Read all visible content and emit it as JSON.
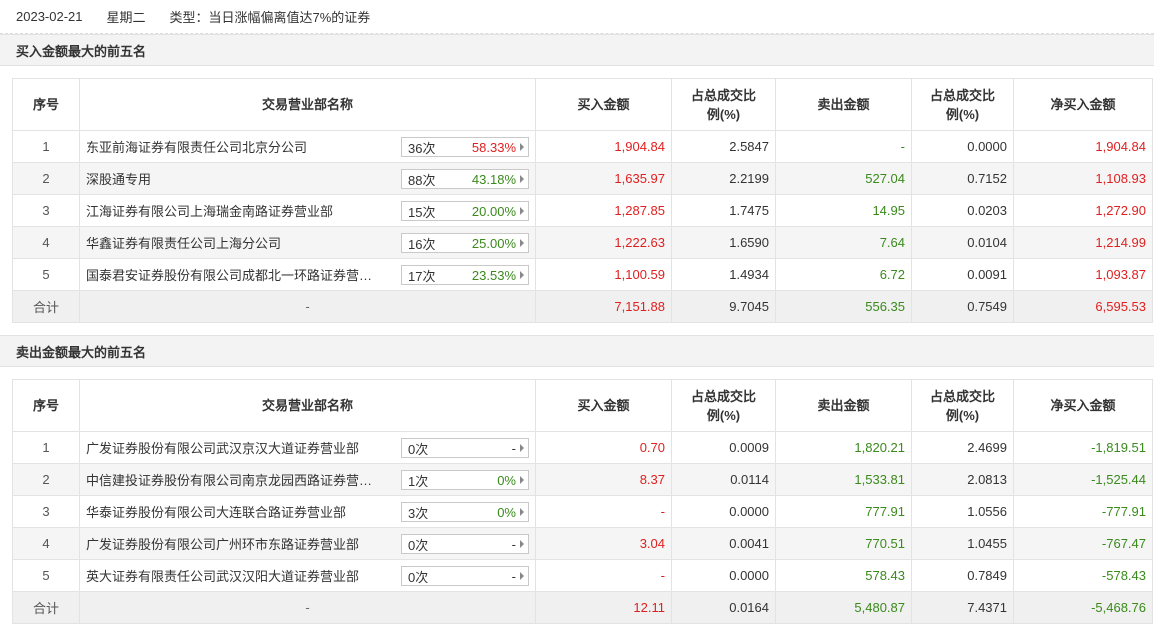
{
  "header": {
    "date": "2023-02-21",
    "weekday": "星期二",
    "type": "类型：当日涨幅偏离值达7%的证券"
  },
  "columns": [
    "序号",
    "交易营业部名称",
    "买入金额",
    "占总成交比例(%)",
    "卖出金额",
    "占总成交比例(%)",
    "净买入金额"
  ],
  "buy_section": {
    "title": "买入金额最大的前五名",
    "rows": [
      {
        "idx": "1",
        "name": "东亚前海证券有限责任公司北京分公司",
        "times": "36次",
        "pct": "58.33%",
        "pct_color": "red",
        "buy": "1,904.84",
        "buy_ratio": "2.5847",
        "sell": "-",
        "sell_ratio": "0.0000",
        "net": "1,904.84",
        "net_color": "red"
      },
      {
        "idx": "2",
        "name": "深股通专用",
        "times": "88次",
        "pct": "43.18%",
        "pct_color": "green",
        "buy": "1,635.97",
        "buy_ratio": "2.2199",
        "sell": "527.04",
        "sell_ratio": "0.7152",
        "net": "1,108.93",
        "net_color": "red"
      },
      {
        "idx": "3",
        "name": "江海证券有限公司上海瑞金南路证券营业部",
        "times": "15次",
        "pct": "20.00%",
        "pct_color": "green",
        "buy": "1,287.85",
        "buy_ratio": "1.7475",
        "sell": "14.95",
        "sell_ratio": "0.0203",
        "net": "1,272.90",
        "net_color": "red"
      },
      {
        "idx": "4",
        "name": "华鑫证券有限责任公司上海分公司",
        "times": "16次",
        "pct": "25.00%",
        "pct_color": "green",
        "buy": "1,222.63",
        "buy_ratio": "1.6590",
        "sell": "7.64",
        "sell_ratio": "0.0104",
        "net": "1,214.99",
        "net_color": "red"
      },
      {
        "idx": "5",
        "name": "国泰君安证券股份有限公司成都北一环路证券营…",
        "times": "17次",
        "pct": "23.53%",
        "pct_color": "green",
        "buy": "1,100.59",
        "buy_ratio": "1.4934",
        "sell": "6.72",
        "sell_ratio": "0.0091",
        "net": "1,093.87",
        "net_color": "red"
      }
    ],
    "total": {
      "label": "合计",
      "name": "-",
      "buy": "7,151.88",
      "buy_ratio": "9.7045",
      "sell": "556.35",
      "sell_ratio": "0.7549",
      "net": "6,595.53",
      "net_color": "red"
    }
  },
  "sell_section": {
    "title": "卖出金额最大的前五名",
    "rows": [
      {
        "idx": "1",
        "name": "广发证券股份有限公司武汉京汉大道证券营业部",
        "times": "0次",
        "pct": "-",
        "pct_color": "dark",
        "buy": "0.70",
        "buy_ratio": "0.0009",
        "sell": "1,820.21",
        "sell_ratio": "2.4699",
        "net": "-1,819.51",
        "net_color": "green"
      },
      {
        "idx": "2",
        "name": "中信建投证券股份有限公司南京龙园西路证券营…",
        "times": "1次",
        "pct": "0%",
        "pct_color": "green",
        "buy": "8.37",
        "buy_ratio": "0.0114",
        "sell": "1,533.81",
        "sell_ratio": "2.0813",
        "net": "-1,525.44",
        "net_color": "green"
      },
      {
        "idx": "3",
        "name": "华泰证券股份有限公司大连联合路证券营业部",
        "times": "3次",
        "pct": "0%",
        "pct_color": "green",
        "buy": "-",
        "buy_ratio": "0.0000",
        "sell": "777.91",
        "sell_ratio": "1.0556",
        "net": "-777.91",
        "net_color": "green"
      },
      {
        "idx": "4",
        "name": "广发证券股份有限公司广州环市东路证券营业部",
        "times": "0次",
        "pct": "-",
        "pct_color": "dark",
        "buy": "3.04",
        "buy_ratio": "0.0041",
        "sell": "770.51",
        "sell_ratio": "1.0455",
        "net": "-767.47",
        "net_color": "green"
      },
      {
        "idx": "5",
        "name": "英大证券有限责任公司武汉汉阳大道证券营业部",
        "times": "0次",
        "pct": "-",
        "pct_color": "dark",
        "buy": "-",
        "buy_ratio": "0.0000",
        "sell": "578.43",
        "sell_ratio": "0.7849",
        "net": "-578.43",
        "net_color": "green"
      }
    ],
    "total": {
      "label": "合计",
      "name": "-",
      "buy": "12.11",
      "buy_ratio": "0.0164",
      "sell": "5,480.87",
      "sell_ratio": "7.4371",
      "net": "-5,468.76",
      "net_color": "green"
    }
  },
  "colors": {
    "up": "#e02020",
    "down": "#3a8a1c",
    "header_bg": "#f3f3f3",
    "stripe": "#f5f5f5"
  },
  "icons": {
    "expand": "chevron-right-icon"
  }
}
